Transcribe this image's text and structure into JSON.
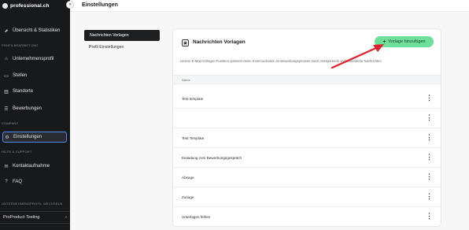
{
  "sidebar": {
    "logo_text": "professional.ch",
    "collapse_glyph": "«",
    "items": [
      {
        "label": "Übersicht & Statistiken",
        "icon": "chart-icon",
        "glyph": "⬈"
      },
      {
        "label": "Unternehmensprofil",
        "icon": "profile-icon",
        "glyph": "⌂"
      },
      {
        "label": "Stellen",
        "icon": "briefcase-icon",
        "glyph": "▭"
      },
      {
        "label": "Standorte",
        "icon": "building-icon",
        "glyph": "▥"
      },
      {
        "label": "Bewerbungen",
        "icon": "applications-icon",
        "glyph": "☰"
      },
      {
        "label": "Einstellungen",
        "icon": "gear-icon",
        "glyph": "⚙"
      },
      {
        "label": "Kontaktaufnahme",
        "icon": "contact-icon",
        "glyph": "✉"
      },
      {
        "label": "FAQ",
        "icon": "faq-icon",
        "glyph": "?"
      }
    ],
    "sections": {
      "profile": "PROFILBEARBEITUNG",
      "company": "COMPANY",
      "help": "HILFE & SUPPORT",
      "switch": "UNTERNEHMENSPROFIL WECHSELN"
    },
    "profile_switch": {
      "label": "ProProduct Testing",
      "chevron": "›"
    }
  },
  "header": {
    "title": "Einstellungen"
  },
  "subnav": {
    "active": "Nachrichten Vorlagen",
    "other": "Profil Einstellungen"
  },
  "card": {
    "icon_glyph": "▣",
    "title": "Nachrichten Vorlagen",
    "add_button": {
      "plus": "+",
      "label": "Vorlage hinzufügen"
    },
    "description": "Unsere E-Mail-Vorlagen-Funktion optimiert deine Kommunikation im Bewerbungsprozess durch zeitsparende und einheitliche Nachrichten",
    "table_header": "Name",
    "kebab_glyph": "⋮",
    "rows": [
      "Test template",
      "",
      "Test Template",
      "Einladung zum Bewerbungsgespräch",
      "Absage",
      "Zusage",
      "Unterlagen fehlen"
    ]
  },
  "colors": {
    "accent": "#6ee09a",
    "sidebar_bg": "#18191b",
    "active_border": "#4d8dff",
    "arrow": "#e0202a"
  }
}
